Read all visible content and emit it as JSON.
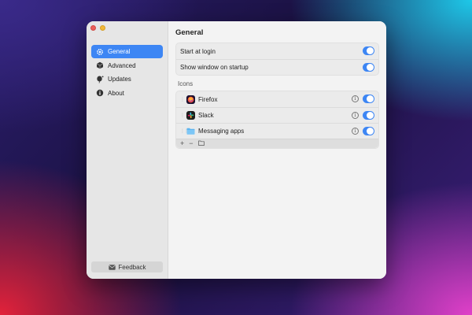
{
  "sidebar": {
    "items": [
      {
        "label": "General",
        "icon": "gear-icon",
        "active": true
      },
      {
        "label": "Advanced",
        "icon": "cube-icon"
      },
      {
        "label": "Updates",
        "icon": "balloon-icon"
      },
      {
        "label": "About",
        "icon": "info-icon"
      }
    ],
    "feedback_label": "Feedback"
  },
  "main": {
    "title": "General",
    "settings": [
      {
        "label": "Start at login",
        "enabled": true
      },
      {
        "label": "Show window on startup",
        "enabled": true
      }
    ],
    "icons_section_label": "Icons",
    "icons": [
      {
        "label": "Firefox",
        "icon": "firefox-icon",
        "enabled": true
      },
      {
        "label": "Slack",
        "icon": "slack-icon",
        "enabled": true
      },
      {
        "label": "Messaging apps",
        "icon": "folder-icon",
        "enabled": true
      }
    ],
    "footer": {
      "add": "+",
      "remove": "−"
    }
  },
  "colors": {
    "accent": "#3d86f4",
    "sidebar_bg": "#e6e6e6"
  }
}
